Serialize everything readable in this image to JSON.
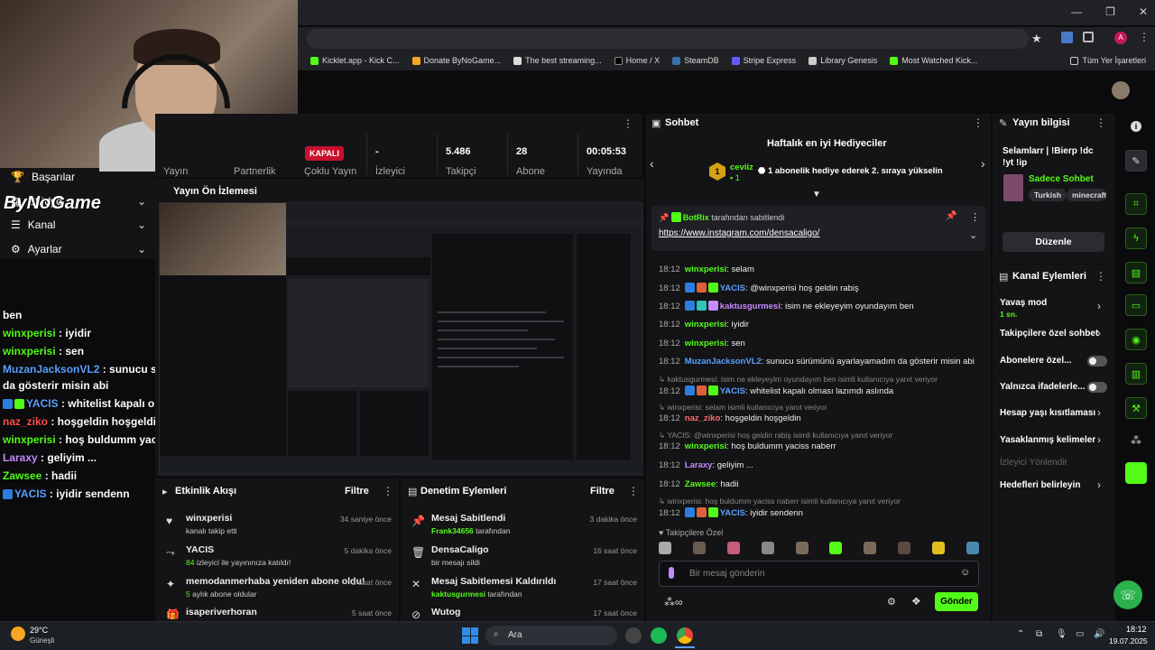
{
  "window": {
    "minimize": "—",
    "maximize": "❐",
    "close": "✕"
  },
  "browser": {
    "bookmarks": [
      "Kicklet.app - Kick C...",
      "Donate ByNoGame...",
      "The best streaming...",
      "Home / X",
      "SteamDB",
      "Stripe Express",
      "Library Genesis",
      "Most Watched Kick..."
    ],
    "all_bookmarks": "Tüm Yer İşaretleri"
  },
  "sidebar": {
    "items": [
      {
        "label": "Başarılar",
        "icon": "trophy-icon"
      },
      {
        "label": "Stüdyo",
        "icon": "studio-icon"
      },
      {
        "label": "Kanal",
        "icon": "channel-icon"
      },
      {
        "label": "Ayarlar",
        "icon": "gear-icon"
      }
    ],
    "overlay_logo": "ByNoGame"
  },
  "overlay_chat": [
    {
      "text": "ben",
      "color": "#ffffff"
    },
    {
      "user": "winxperisi",
      "text": " : iyidir",
      "color": "#53fc18"
    },
    {
      "user": "winxperisi",
      "text": " : sen",
      "color": "#53fc18"
    },
    {
      "user": "MuzanJacksonVL2",
      "text": " : sunucu sürümünü ayarlayamadım",
      "color": "#5aa0ff"
    },
    {
      "text": "da gösterir misin abi",
      "color": "#ffffff"
    },
    {
      "user": "YACIS",
      "text": " : whitelist kapalı olması lazımdı aslında",
      "color": "#5aa0ff"
    },
    {
      "user": "naz_ziko",
      "text": " : hoşgeldin hoşgeldin",
      "color": "#ff4d4d"
    },
    {
      "user": "winxperisi",
      "text": " : hoş buldumm yaciss naberr",
      "color": "#53fc18"
    },
    {
      "user": "Laraxy",
      "text": " : geliyim ...",
      "color": "#c58bff"
    },
    {
      "user": "Zawsee",
      "text": " : hadii",
      "color": "#53fc18"
    },
    {
      "user": "YACIS",
      "text": " : iyidir sendenn",
      "color": "#5aa0ff"
    }
  ],
  "stats": {
    "status": "KAPALI",
    "items": [
      {
        "value": "",
        "label": "Yayın"
      },
      {
        "value": "",
        "label": "Partnerlik"
      },
      {
        "value": "",
        "label": "Çoklu Yayın"
      },
      {
        "value": "-",
        "label": "İzleyici"
      },
      {
        "value": "5.486",
        "label": "Takipçi"
      },
      {
        "value": "28",
        "label": "Abone"
      },
      {
        "value": "00:05:53",
        "label": "Yayında"
      }
    ]
  },
  "preview": {
    "title": "Yayın Ön İzlemesi"
  },
  "activity": {
    "title": "Etkinlik Akışı",
    "filter": "Filtre",
    "items": [
      {
        "icon": "heart-icon",
        "title": "winxperisi",
        "sub": "kanalı takip etti",
        "time": "34 saniye önce"
      },
      {
        "icon": "raid-icon",
        "title": "YACIS",
        "sub_green": "84",
        "sub": " izleyici ile yayınınıza katıldı!",
        "time": "5 dakika önce"
      },
      {
        "icon": "sparkle-icon",
        "title": "memodanmerhaba yeniden abone oldu!",
        "sub_green": "5",
        "sub": " aylık abone oldular",
        "time": "2 saat önce"
      },
      {
        "icon": "gift-icon",
        "title": "isaperiverhoran",
        "sub": "",
        "time": "5 saat önce"
      }
    ]
  },
  "moderation": {
    "title": "Denetim Eylemleri",
    "filter": "Filtre",
    "items": [
      {
        "icon": "pin-icon",
        "title": "Mesaj Sabitlendi",
        "sub_green": "Frank34656",
        "sub": " tarafından",
        "time": "3 dakika önce"
      },
      {
        "icon": "trash-icon",
        "title": "DensaCaligo",
        "sub": "bir mesajı sildi",
        "time": "16 saat önce"
      },
      {
        "icon": "unpin-icon",
        "title": "Mesaj Sabitlemesi Kaldırıldı",
        "sub_green": "kaktusgurmesi",
        "sub": " tarafından",
        "time": "17 saat önce"
      },
      {
        "icon": "mute-icon",
        "title": "Wutog",
        "sub": "",
        "time": "17 saat önce"
      }
    ]
  },
  "chat": {
    "title": "Sohbet",
    "gifter_header": "Haftalık en iyi Hediyeciler",
    "gifter_rank": "1",
    "gifter_name": "ceviiz",
    "gifter_count": "1",
    "gifter_text": "1 abonelik hediye ederek 2. sıraya yükselin",
    "pinned_by": "BotRix",
    "pinned_suffix": " tarafından sabitlendi",
    "pinned_link": "https://www.instagram.com/densacaligo/",
    "messages": [
      {
        "time": "18:12",
        "user": "winxperisi",
        "cls": "u-green",
        "text": ": selam"
      },
      {
        "time": "18:12",
        "user": "YACIS",
        "cls": "u-blue",
        "text": ": @winxperisi hoş geldin rabiş"
      },
      {
        "time": "18:12",
        "user": "kaktusgurmesi",
        "cls": "u-purple",
        "text": ": isim ne ekleyeyim oyundayım ben"
      },
      {
        "time": "18:12",
        "user": "winxperisi",
        "cls": "u-green",
        "text": ": iyidir"
      },
      {
        "time": "18:12",
        "user": "winxperisi",
        "cls": "u-green",
        "text": ": sen"
      },
      {
        "time": "18:12",
        "user": "MuzanJacksonVL2",
        "cls": "u-blue",
        "text": ": sunucu sürümünü ayarlayamadım da gösterir misin abi"
      },
      {
        "reply": "kaktusgurmesi: isim ne ekleyeyim oyundayım ben isimli kullanıcıya yanıt veriyor"
      },
      {
        "time": "18:12",
        "user": "YACIS",
        "cls": "u-blue",
        "text": ": whitelist kapalı olması lazımdı aslında"
      },
      {
        "reply": "winxperisi: selam isimli kullanıcıya yanıt veriyor"
      },
      {
        "time": "18:12",
        "user": "naz_ziko",
        "cls": "u-red",
        "text": ": hoşgeldin hoşgeldin"
      },
      {
        "reply": "YACIS: @winxperisi hoş geldin rabiş isimli kullanıcıya yanıt veriyor"
      },
      {
        "time": "18:12",
        "user": "winxperisi",
        "cls": "u-green",
        "text": ": hoş buldumm yaciss naberr"
      },
      {
        "time": "18:12",
        "user": "Laraxy",
        "cls": "u-purple",
        "text": ": geliyim ..."
      },
      {
        "time": "18:12",
        "user": "Zawsee",
        "cls": "u-green",
        "text": ": hadii"
      },
      {
        "reply": "winxperisi: hoş buldumm yaciss naberr isimli kullanıcıya yanıt veriyor"
      },
      {
        "time": "18:12",
        "user": "YACIS",
        "cls": "u-blue",
        "text": ": iyidir sendenn"
      }
    ],
    "followers_only_label": "Takipçilere Özel",
    "input_placeholder": "Bir mesaj gönderin",
    "send_label": "Gönder"
  },
  "stream_info": {
    "title": "Yayın bilgisi",
    "stream_title": "Selamlarr | !Bierp !dc !yt !ip",
    "category": "Sadece Sohbet",
    "tags": [
      "Turkish",
      "minecraft"
    ],
    "edit_label": "Düzenle"
  },
  "channel_actions": {
    "title": "Kanal Eylemleri",
    "slow_mode": "Yavaş mod",
    "slow_mode_value": "1 sn.",
    "followers_only": "Takipçilere özel sohbet",
    "subscribers_only": "Abonelere özel...",
    "emotes_only": "Yalnızca ifadelerle...",
    "account_age": "Hesap yaşı kısıtlaması",
    "banned_words": "Yasaklanmış kelimeler",
    "viewer_redirect": "İzleyici Yönlendir",
    "set_goals": "Hedefleri belirleyin"
  },
  "taskbar": {
    "weather_temp": "29°C",
    "weather_desc": "Güneşli",
    "search": "Ara",
    "time": "18:12",
    "date": "19.07.2025"
  }
}
